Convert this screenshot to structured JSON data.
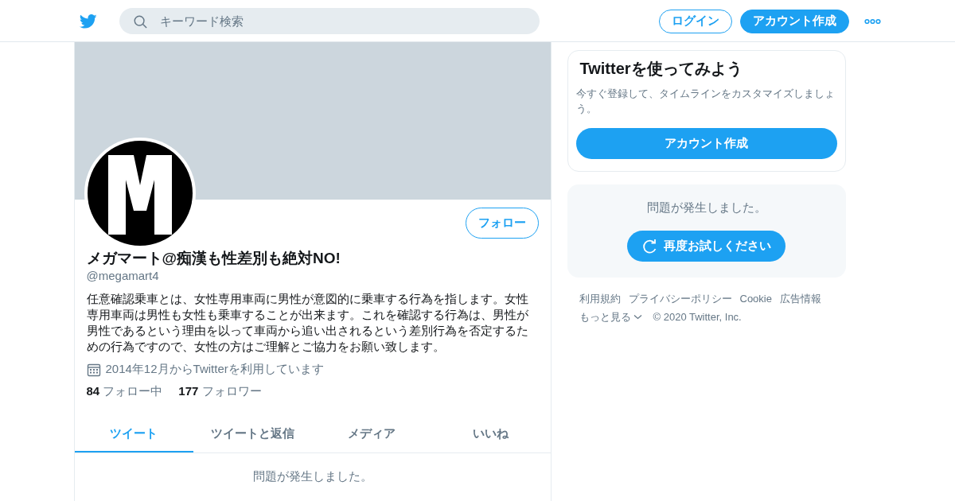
{
  "header": {
    "search": {
      "placeholder": "キーワード検索"
    },
    "buttons": [
      {
        "label": "ログイン",
        "kind": "outline"
      },
      {
        "label": "アカウント作成",
        "kind": "filled"
      }
    ]
  },
  "profile": {
    "follow_button": "フォロー",
    "name": "メガマート@痴漢も性差別も絶対NO!",
    "handle": "@megamart4",
    "bio": "任意確認乗車とは、女性専用車両に男性が意図的に乗車する行為を指します。女性専用車両は男性も女性も乗車することが出来ます。これを確認する行為は、男性が男性であるという理由を以って車両から追い出されるという差別行為を否定するための行為ですので、女性の方はご理解とご協力をお願い致します。",
    "joined": "2014年12月からTwitterを利用しています",
    "stats": [
      {
        "count": "84",
        "label": "フォロー中"
      },
      {
        "count": "177",
        "label": "フォロワー"
      }
    ]
  },
  "tabs": [
    {
      "label": "ツイート",
      "selected": true
    },
    {
      "label": "ツイートと返信",
      "selected": false
    },
    {
      "label": "メディア",
      "selected": false
    },
    {
      "label": "いいね",
      "selected": false
    }
  ],
  "timeline_message": "問題が発生しました。",
  "signup_card": {
    "title": "Twitterを使ってみよう",
    "text": "今すぐ登録して、タイムラインをカスタマイズしましょう。",
    "button": "アカウント作成"
  },
  "error_card": {
    "message": "問題が発生しました。",
    "retry_button": "再度お試しください"
  },
  "footer": {
    "links": [
      "利用規約",
      "プライバシーポリシー",
      "Cookie",
      "広告情報"
    ],
    "more": "もっと見る",
    "copyright": "© 2020 Twitter, Inc."
  }
}
